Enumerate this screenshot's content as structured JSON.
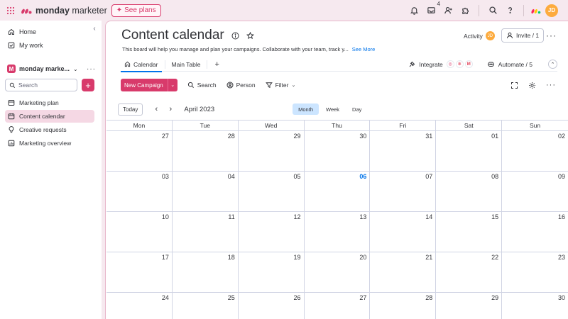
{
  "topbar": {
    "brand_bold": "monday",
    "brand_rest": " marketer",
    "see_plans": "See plans",
    "inbox_count": "4",
    "avatar_initials": "JD",
    "colors": {
      "brand": "#d83a6b",
      "avatar": "#fdab3d"
    }
  },
  "sidebar": {
    "home": "Home",
    "my_work": "My work",
    "workspace_badge": "M",
    "workspace_name": "monday marke...",
    "search_placeholder": "Search",
    "items": [
      {
        "label": "Marketing plan",
        "icon": "board-icon"
      },
      {
        "label": "Content calendar",
        "icon": "calendar-icon",
        "active": true
      },
      {
        "label": "Creative requests",
        "icon": "lightbulb-icon"
      },
      {
        "label": "Marketing overview",
        "icon": "dashboard-icon"
      }
    ]
  },
  "board": {
    "title": "Content calendar",
    "description": "This board will help you manage and plan your campaigns. Collaborate with your team, track y...",
    "see_more": "See More",
    "activity_label": "Activity",
    "activity_avatar": "JD",
    "invite_label": "Invite / 1",
    "tabs": {
      "calendar": "Calendar",
      "main_table": "Main Table"
    },
    "integrate": "Integrate",
    "automate": "Automate / 5",
    "new_button": "New Campaign",
    "search": "Search",
    "person": "Person",
    "filter": "Filter"
  },
  "calendar": {
    "today_button": "Today",
    "month_label": "April 2023",
    "views": [
      "Month",
      "Week",
      "Day"
    ],
    "active_view": "Month",
    "weekdays": [
      "Mon",
      "Tue",
      "Wed",
      "Thu",
      "Fri",
      "Sat",
      "Sun"
    ],
    "days": [
      "27",
      "28",
      "29",
      "30",
      "31",
      "01",
      "02",
      "03",
      "04",
      "05",
      "06",
      "07",
      "08",
      "09",
      "10",
      "11",
      "12",
      "13",
      "14",
      "15",
      "16",
      "17",
      "18",
      "19",
      "20",
      "21",
      "22",
      "23",
      "24",
      "25",
      "26",
      "27",
      "28",
      "29",
      "30"
    ],
    "today": "06",
    "accent_color": "#0073ea"
  }
}
